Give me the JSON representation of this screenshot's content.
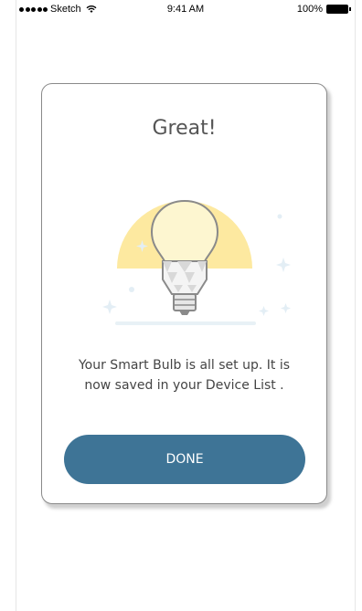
{
  "status_bar": {
    "carrier": "Sketch",
    "time": "9:41 AM",
    "battery_percent": "100%"
  },
  "dialog": {
    "title": "Great!",
    "message_line1": "Your Smart Bulb is all set up. It is",
    "message_line2": "now saved in your Device List  .",
    "done_label": "DONE"
  },
  "illustration": {
    "icon": "light-bulb-icon",
    "glow_color": "#fde9a0",
    "bulb_color": "#f4f4f4",
    "sparkle_color": "#e3eef5"
  },
  "colors": {
    "primary_button": "#3e7496",
    "button_text": "#ffffff",
    "title_text": "#555555"
  }
}
